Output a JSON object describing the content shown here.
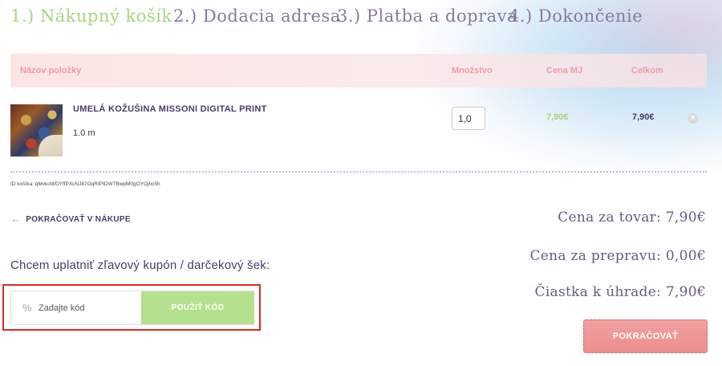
{
  "steps": [
    {
      "label": "1.) Nákupný košík",
      "active": true
    },
    {
      "label": "2.) Dodacia adresa",
      "active": false
    },
    {
      "label": "3.) Platba a doprava",
      "active": false
    },
    {
      "label": "4.) Dokončenie",
      "active": false
    }
  ],
  "table": {
    "headers": {
      "name": "Názov položky",
      "quantity": "Množstvo",
      "unit_price": "Cena MJ",
      "total": "Celkom"
    },
    "items": [
      {
        "name": "UMELÁ KOŽUŠINA MISSONI DIGITAL PRINT",
        "amount_text": "1.0 m",
        "quantity": "1,0",
        "unit_price": "7,90€",
        "total": "7,90€"
      }
    ]
  },
  "cart_id": "ID košíka: qMvkoWDYffPXcNJ87OqRIPtDW7BwpM0gOYOjhc5h",
  "continue_shopping": "POKRAČOVAŤ V NÁKUPE",
  "summary": {
    "goods": "Cena za tovar: 7,90€",
    "shipping": "Cena za prepravu: 0,00€",
    "to_pay": "Čiastka k úhrade: 7,90€"
  },
  "coupon": {
    "title": "Chcem uplatniť zľavový kupón / darčekový šek:",
    "placeholder": "Zadajte kód",
    "apply_label": "POUŽIŤ KÓD",
    "icon": "percent-icon"
  },
  "checkout_label": "POKRAČOVAŤ",
  "colors": {
    "accent_green": "#a8d680",
    "accent_pink": "#ec8e8e",
    "highlight_red": "#e02626",
    "text_purple": "#4a3a6a"
  }
}
